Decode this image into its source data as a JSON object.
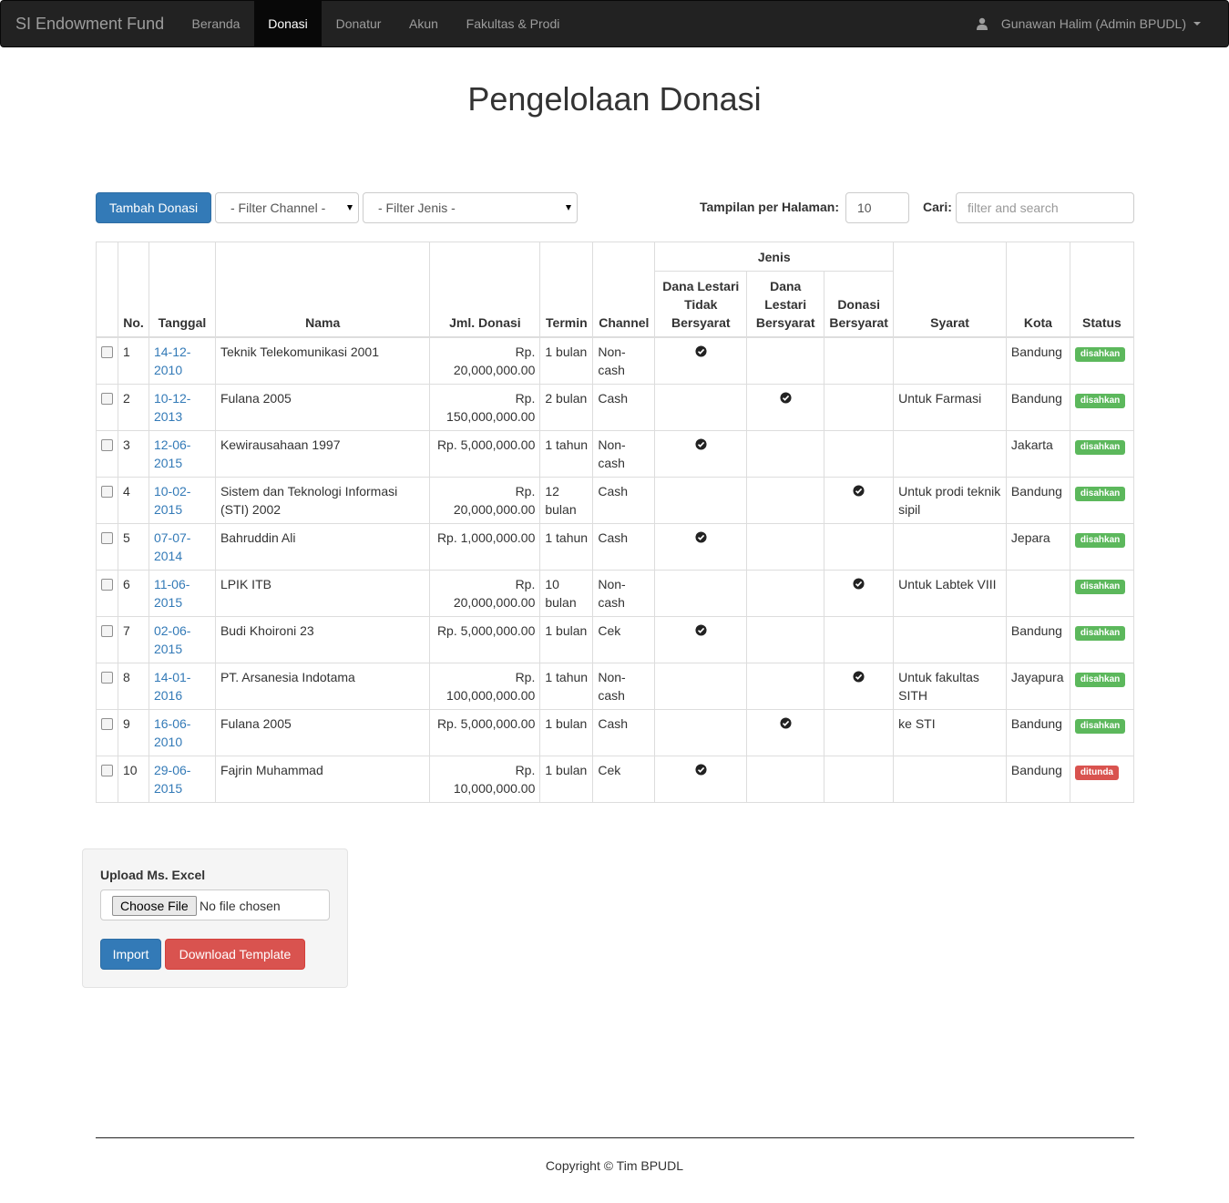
{
  "navbar": {
    "brand": "SI Endowment Fund",
    "items": [
      {
        "label": "Beranda"
      },
      {
        "label": "Donasi"
      },
      {
        "label": "Donatur"
      },
      {
        "label": "Akun"
      },
      {
        "label": "Fakultas & Prodi"
      }
    ],
    "active": "Donasi",
    "user": "Gunawan Halim (Admin BPUDL)"
  },
  "page": {
    "title": "Pengelolaan Donasi"
  },
  "toolbar": {
    "add_button": "Tambah Donasi",
    "filter_channel": "- Filter Channel -",
    "filter_jenis": "- Filter Jenis -",
    "per_page_label": "Tampilan per Halaman:",
    "per_page_value": "10",
    "search_label": "Cari:",
    "search_placeholder": "filter and search"
  },
  "table": {
    "headers": {
      "no": "No.",
      "tanggal": "Tanggal",
      "nama": "Nama",
      "jml": "Jml. Donasi",
      "termin": "Termin",
      "channel": "Channel",
      "jenis": "Jenis",
      "jenis_1": "Dana Lestari Tidak Bersyarat",
      "jenis_2": "Dana Lestari Bersyarat",
      "jenis_3": "Donasi Bersyarat",
      "syarat": "Syarat",
      "kota": "Kota",
      "status": "Status"
    },
    "rows": [
      {
        "no": "1",
        "tanggal": "14-12-2010",
        "nama": "Teknik Telekomunikasi 2001",
        "jml": "Rp. 20,000,000.00",
        "termin": "1 bulan",
        "channel": "Non-cash",
        "jenis": 1,
        "syarat": "",
        "kota": "Bandung",
        "status": "disahkan",
        "status_color": "#5cb85c"
      },
      {
        "no": "2",
        "tanggal": "10-12-2013",
        "nama": "Fulana 2005",
        "jml": "Rp. 150,000,000.00",
        "termin": "2 bulan",
        "channel": "Cash",
        "jenis": 2,
        "syarat": "Untuk Farmasi",
        "kota": "Bandung",
        "status": "disahkan",
        "status_color": "#5cb85c"
      },
      {
        "no": "3",
        "tanggal": "12-06-2015",
        "nama": "Kewirausahaan 1997",
        "jml": "Rp. 5,000,000.00",
        "termin": "1 tahun",
        "channel": "Non-cash",
        "jenis": 1,
        "syarat": "",
        "kota": "Jakarta",
        "status": "disahkan",
        "status_color": "#5cb85c"
      },
      {
        "no": "4",
        "tanggal": "10-02-2015",
        "nama": "Sistem dan Teknologi Informasi (STI) 2002",
        "jml": "Rp. 20,000,000.00",
        "termin": "12 bulan",
        "channel": "Cash",
        "jenis": 3,
        "syarat": "Untuk prodi teknik sipil",
        "kota": "Bandung",
        "status": "disahkan",
        "status_color": "#5cb85c"
      },
      {
        "no": "5",
        "tanggal": "07-07-2014",
        "nama": "Bahruddin Ali",
        "jml": "Rp. 1,000,000.00",
        "termin": "1 tahun",
        "channel": "Cash",
        "jenis": 1,
        "syarat": "",
        "kota": "Jepara",
        "status": "disahkan",
        "status_color": "#5cb85c"
      },
      {
        "no": "6",
        "tanggal": "11-06-2015",
        "nama": "LPIK ITB",
        "jml": "Rp. 20,000,000.00",
        "termin": "10 bulan",
        "channel": "Non-cash",
        "jenis": 3,
        "syarat": "Untuk Labtek VIII",
        "kota": "",
        "status": "disahkan",
        "status_color": "#5cb85c"
      },
      {
        "no": "7",
        "tanggal": "02-06-2015",
        "nama": "Budi Khoironi 23",
        "jml": "Rp. 5,000,000.00",
        "termin": "1 bulan",
        "channel": "Cek",
        "jenis": 1,
        "syarat": "",
        "kota": "Bandung",
        "status": "disahkan",
        "status_color": "#5cb85c"
      },
      {
        "no": "8",
        "tanggal": "14-01-2016",
        "nama": "PT. Arsanesia Indotama",
        "jml": "Rp. 100,000,000.00",
        "termin": "1 tahun",
        "channel": "Non-cash",
        "jenis": 3,
        "syarat": "Untuk fakultas SITH",
        "kota": "Jayapura",
        "status": "disahkan",
        "status_color": "#5cb85c"
      },
      {
        "no": "9",
        "tanggal": "16-06-2010",
        "nama": "Fulana 2005",
        "jml": "Rp. 5,000,000.00",
        "termin": "1 bulan",
        "channel": "Cash",
        "jenis": 2,
        "syarat": "ke STI",
        "kota": "Bandung",
        "status": "disahkan",
        "status_color": "#5cb85c"
      },
      {
        "no": "10",
        "tanggal": "29-06-2015",
        "nama": "Fajrin Muhammad",
        "jml": "Rp. 10,000,000.00",
        "termin": "1 bulan",
        "channel": "Cek",
        "jenis": 1,
        "syarat": "",
        "kota": "Bandung",
        "status": "ditunda",
        "status_color": "#d9534f"
      }
    ]
  },
  "upload": {
    "title": "Upload Ms. Excel",
    "choose_file": "Choose File",
    "no_file": "No file chosen",
    "import_button": "Import",
    "download_button": "Download Template"
  },
  "footer": {
    "copyright": "Copyright © Tim BPUDL"
  },
  "icons": {
    "user": "user-icon",
    "check": "check-circle-icon",
    "caret": "caret-down-icon"
  }
}
